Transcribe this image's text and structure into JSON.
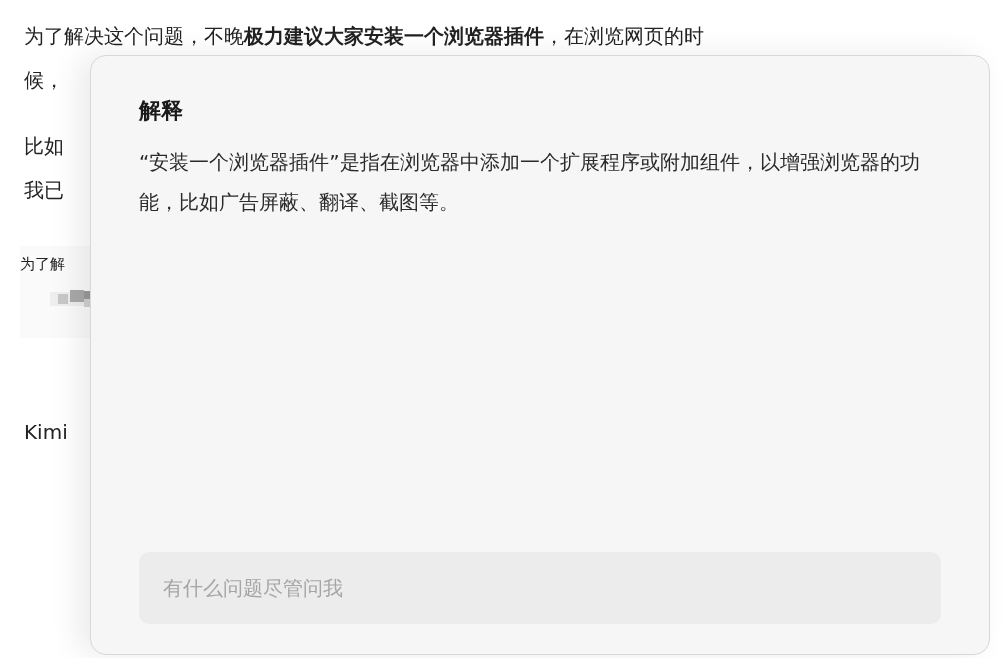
{
  "article": {
    "paragraphs": [
      {
        "lines": [
          "为了解决这个问题，不晚**极力建议大家安装一个浏览器插件**，在浏览网页的时",
          "候，"
        ]
      },
      {
        "lines": [
          "比如",
          "我已"
        ]
      }
    ],
    "inset": {
      "caption": "为了解"
    },
    "trailing": "Kimi"
  },
  "popup": {
    "title": "解释",
    "body": "“安装一个浏览器插件”是指在浏览器中添加一个扩展程序或附加组件，以增强浏览器的功能，比如广告屏蔽、翻译、截图等。",
    "input": {
      "placeholder": "有什么问题尽管问我"
    }
  }
}
